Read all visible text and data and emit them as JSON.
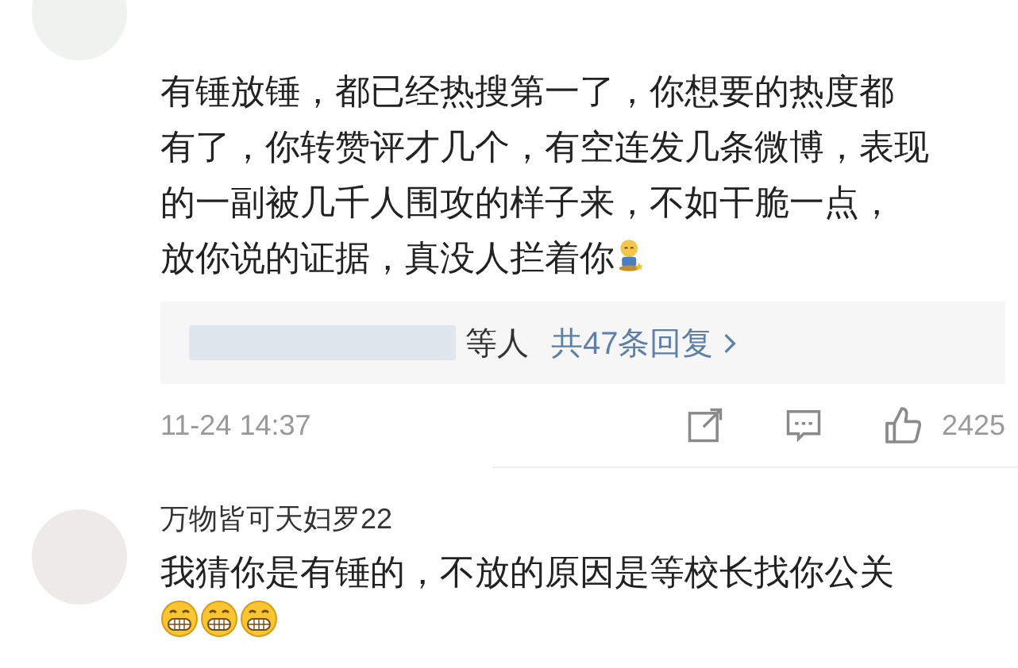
{
  "comments": [
    {
      "lines": [
        "有锤放锤，都已经热搜第一了，你想要的热度都",
        "有了，你转赞评才几个，有空连发几条微博，表现",
        "的一副被几千人围攻的样子来，不如干脆一点，",
        "放你说的证据，真没人拦着你"
      ],
      "emoji": [
        {
          "kind": "figure"
        }
      ],
      "reply_summary": {
        "names_obscured": true,
        "suffix": "等人",
        "count": "共47条回复"
      },
      "time": "11-24 14:37",
      "likes": "2425"
    },
    {
      "name": "万物皆可天妇罗22",
      "lines": [
        "我猜你是有锤的，不放的原因是等校长找你公关"
      ],
      "emoji": [
        {
          "kind": "grin"
        },
        {
          "kind": "grin"
        },
        {
          "kind": "grin"
        }
      ]
    }
  ]
}
